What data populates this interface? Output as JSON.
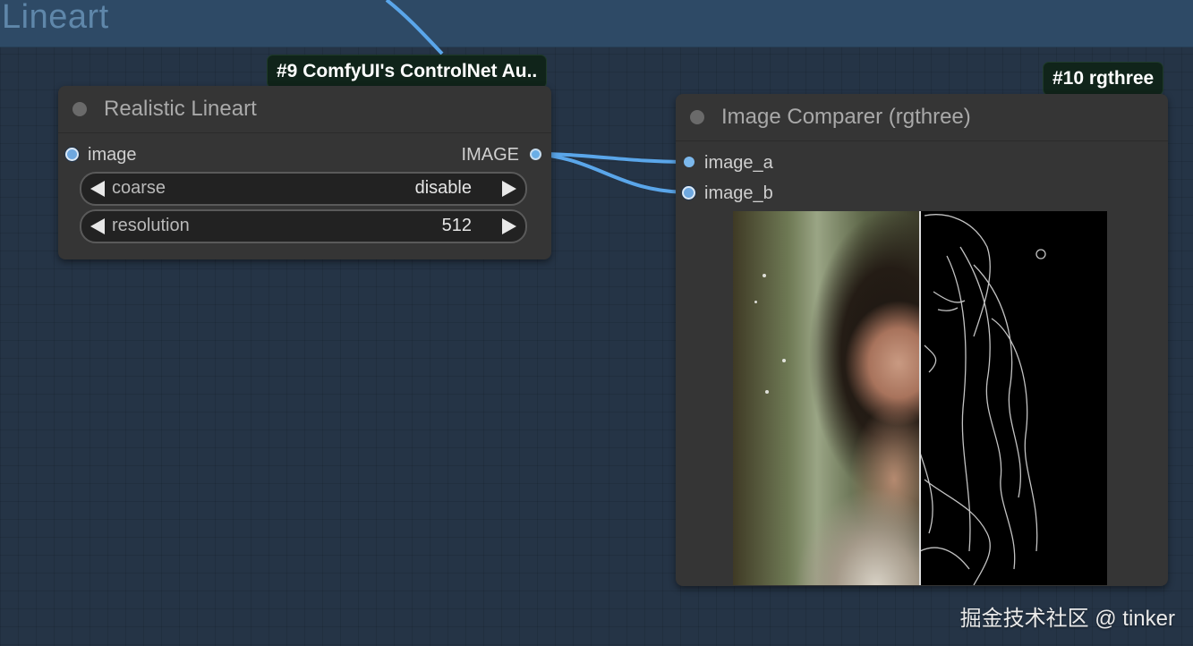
{
  "group": {
    "title": "Lineart"
  },
  "nodes": {
    "lineart": {
      "badge": "#9 ComfyUI's ControlNet Au..",
      "title": "Realistic Lineart",
      "input_label": "image",
      "output_label": "IMAGE",
      "widgets": [
        {
          "label": "coarse",
          "value": "disable"
        },
        {
          "label": "resolution",
          "value": "512"
        }
      ]
    },
    "comparer": {
      "badge": "#10 rgthree",
      "title": "Image Comparer (rgthree)",
      "inputs": [
        "image_a",
        "image_b"
      ]
    }
  },
  "colors": {
    "canvas": "#253446",
    "group_band": "#2e4a66",
    "link": "#5aa6ea",
    "node_bg": "#353535",
    "badge_bg": "#10241a"
  },
  "watermark": "掘金技术社区 @ tinker"
}
